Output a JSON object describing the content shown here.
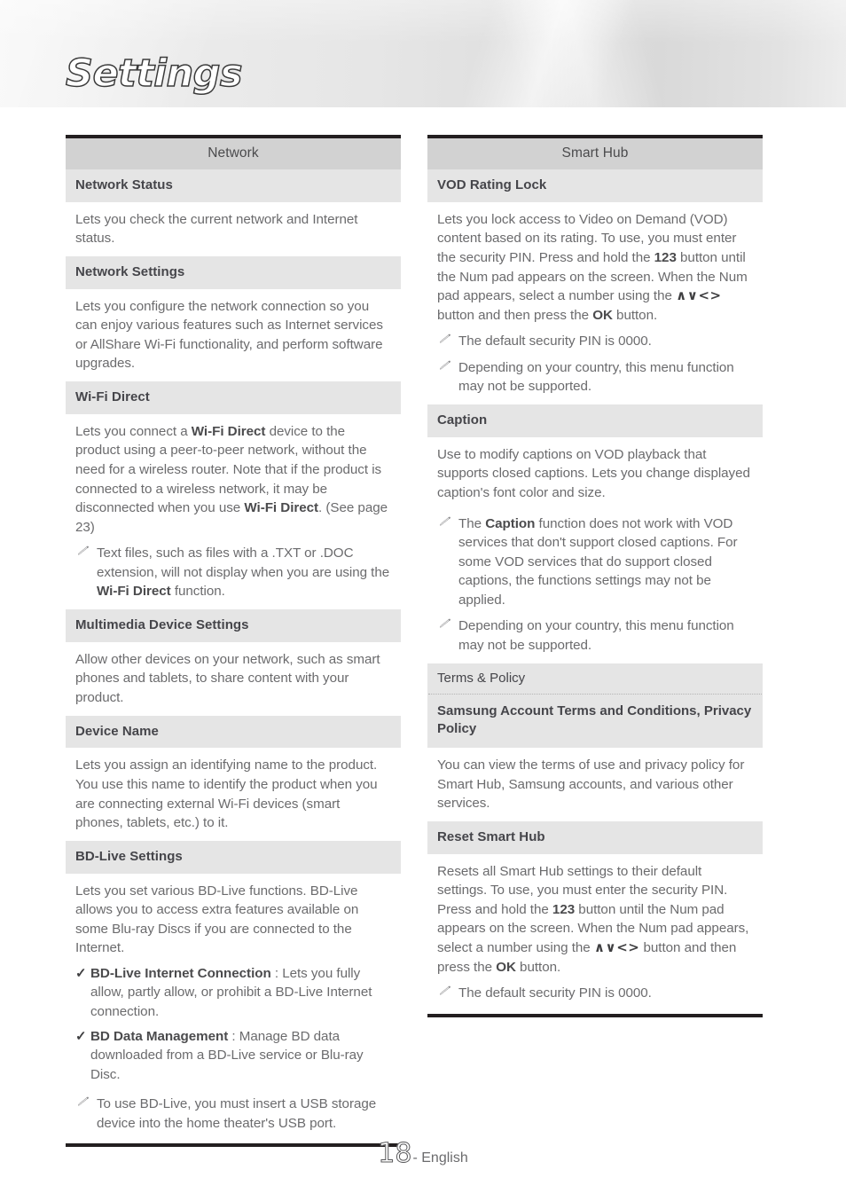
{
  "header": {
    "title": "Settings"
  },
  "left_column": {
    "section_title": "Network",
    "blocks": {
      "network_status": {
        "header": "Network Status",
        "body": "Lets you check the current network and Internet status."
      },
      "network_settings": {
        "header": "Network Settings",
        "body": "Lets you configure the network connection so you can enjoy various features such as Internet services or AllShare Wi-Fi functionality, and perform software upgrades."
      },
      "wifi_direct": {
        "header": "Wi-Fi Direct",
        "body_part1": "Lets you connect a ",
        "body_bold1": "Wi-Fi Direct",
        "body_part2": " device to the product using a peer-to-peer network, without the need for a wireless router. Note that if the product is connected to a wireless network, it may be disconnected when you use ",
        "body_bold2": "Wi-Fi Direct",
        "body_part3": ". (See page 23)",
        "note_part1": "Text files, such as files with a .TXT or .DOC extension, will not display when you are using the ",
        "note_bold1": "Wi-Fi Direct",
        "note_part2": " function."
      },
      "multimedia_device_settings": {
        "header": "Multimedia Device Settings",
        "body": "Allow other devices on your network, such as smart phones and tablets, to share content with your product."
      },
      "device_name": {
        "header": "Device Name",
        "body": "Lets you assign an identifying name to the product. You use this name to identify the product when you are connecting external Wi-Fi devices (smart phones, tablets, etc.) to it."
      },
      "bd_live_settings": {
        "header": "BD-Live Settings",
        "body": "Lets you set various BD-Live functions. BD-Live allows you to access extra features available on some Blu-ray Discs if you are connected to the Internet.",
        "check1_bold": "BD-Live Internet Connection",
        "check1_rest": " : Lets you fully allow, partly allow, or prohibit a BD-Live Internet connection.",
        "check2_bold": "BD Data Management",
        "check2_rest": " : Manage BD data downloaded from a BD-Live service or Blu-ray Disc.",
        "note": "To use BD-Live, you must insert a USB storage device into the home theater's USB port."
      }
    }
  },
  "right_column": {
    "section_title": "Smart Hub",
    "blocks": {
      "vod_rating_lock": {
        "header": "VOD Rating Lock",
        "body_part1": "Lets you lock access to Video on Demand (VOD) content based on its rating. To use, you must enter the security PIN. Press and hold the ",
        "body_bold1": "123",
        "body_part2": " button until the Num pad appears on the screen. When the Num pad appears, select a number using the ",
        "body_arrows": "∧∨<>",
        "body_part3": " button and then press the ",
        "body_bold2": "OK",
        "body_part4": " button.",
        "note1": "The default security PIN is 0000.",
        "note2": "Depending on your country, this menu function may not be supported."
      },
      "caption": {
        "header": "Caption",
        "body": "Use to modify captions on VOD playback that supports closed captions. Lets you change displayed caption's font color and size.",
        "note1_part1": "The ",
        "note1_bold": "Caption",
        "note1_part2": " function does not work with VOD services that don't support closed captions. For some VOD services that do support closed captions, the functions settings may not be applied.",
        "note2": "Depending on your country, this menu function may not be supported."
      },
      "terms_policy": {
        "header": "Terms & Policy",
        "subheader": "Samsung Account Terms and Conditions, Privacy Policy",
        "body": "You can view the terms of use and privacy policy for Smart Hub, Samsung accounts, and various other services."
      },
      "reset_smart_hub": {
        "header": "Reset Smart Hub",
        "body_part1": "Resets all Smart Hub settings to their default settings. To use, you must enter the security PIN. Press and hold the ",
        "body_bold1": "123",
        "body_part2": " button until the Num pad appears on the screen. When the Num pad appears, select a number using the ",
        "body_arrows": "∧∨<>",
        "body_part3": " button and then press the ",
        "body_bold2": "OK",
        "body_part4": " button.",
        "note1": "The default security PIN is 0000."
      }
    }
  },
  "footer": {
    "page_number": "18",
    "language": "- English"
  },
  "icons": {
    "note_icon": "pencil-icon",
    "check_icon": "✓"
  }
}
